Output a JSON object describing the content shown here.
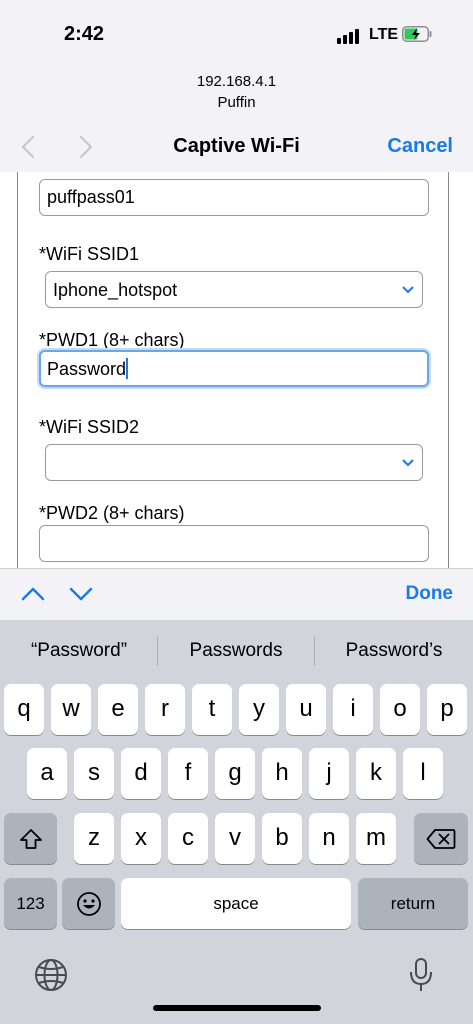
{
  "status_bar": {
    "time": "2:42",
    "network": "LTE"
  },
  "browser": {
    "url": "192.168.4.1",
    "site_name": "Puffin"
  },
  "navbar": {
    "title": "Captive Wi-Fi",
    "cancel_label": "Cancel"
  },
  "form": {
    "password0_value": "puffpass01",
    "ssid1_label": "*WiFi SSID1",
    "ssid1_value": "Iphone_hotspot",
    "pwd1_label": "*PWD1 (8+ chars)",
    "pwd1_value": "Password",
    "ssid2_label": "*WiFi SSID2",
    "ssid2_value": "",
    "pwd2_label": "*PWD2 (8+ chars)",
    "pwd2_value": ""
  },
  "accessory": {
    "done_label": "Done"
  },
  "keyboard": {
    "suggestions": [
      "“Password”",
      "Passwords",
      "Password’s"
    ],
    "row1": [
      "q",
      "w",
      "e",
      "r",
      "t",
      "y",
      "u",
      "i",
      "o",
      "p"
    ],
    "row2": [
      "a",
      "s",
      "d",
      "f",
      "g",
      "h",
      "j",
      "k",
      "l"
    ],
    "row3": [
      "z",
      "x",
      "c",
      "v",
      "b",
      "n",
      "m"
    ],
    "numbers_label": "123",
    "space_label": "space",
    "return_label": "return"
  },
  "colors": {
    "accent": "#1a7ae6",
    "keyboard_bg": "#d1d4da",
    "focus_ring": "#6aa6e8"
  }
}
